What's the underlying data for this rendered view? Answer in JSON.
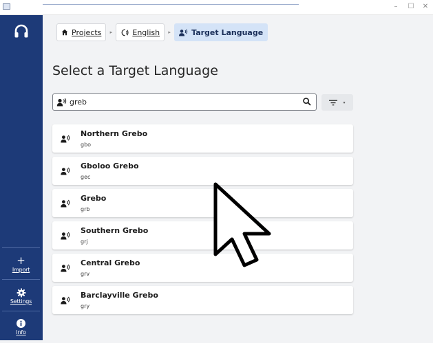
{
  "window": {
    "controls": {
      "minimize": "–",
      "maximize": "☐",
      "close": "✕"
    }
  },
  "sidebar": {
    "logo_icon": "headphones-icon",
    "items": [
      {
        "label": "Import",
        "icon": "plus-icon"
      },
      {
        "label": "Settings",
        "icon": "gear-icon"
      },
      {
        "label": "Info",
        "icon": "info-icon"
      }
    ]
  },
  "breadcrumb": [
    {
      "label": "Projects",
      "icon": "home-icon"
    },
    {
      "label": "English",
      "icon": "speech-icon"
    },
    {
      "label": "Target Language",
      "icon": "speaker-person-icon"
    }
  ],
  "page": {
    "title": "Select a Target Language"
  },
  "search": {
    "value": "greb",
    "leading_icon": "speaker-person-icon",
    "trailing_icon": "search-icon"
  },
  "filter": {
    "icon": "filter-icon",
    "chevron": "▾"
  },
  "languages": [
    {
      "name": "Northern Grebo",
      "code": "gbo"
    },
    {
      "name": "Gboloo Grebo",
      "code": "gec"
    },
    {
      "name": "Grebo",
      "code": "grb"
    },
    {
      "name": "Southern Grebo",
      "code": "grj"
    },
    {
      "name": "Central Grebo",
      "code": "grv"
    },
    {
      "name": "Barclayville Grebo",
      "code": "gry"
    }
  ],
  "colors": {
    "sidebar": "#1d3a78",
    "active_crumb": "#d4e3f7",
    "background": "#f2f3f5"
  }
}
